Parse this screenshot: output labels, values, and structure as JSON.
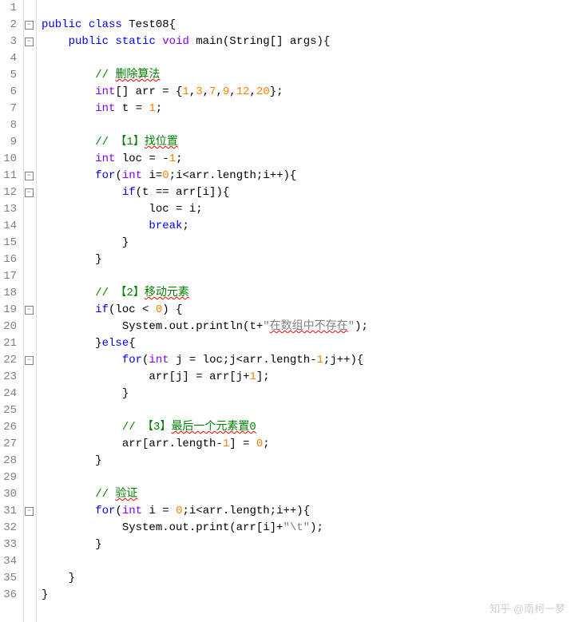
{
  "lines": [
    {
      "n": 1,
      "fold": "",
      "indent": "",
      "tokens": []
    },
    {
      "n": 2,
      "fold": "open",
      "indent": "",
      "tokens": [
        [
          "kw",
          "public"
        ],
        [
          "",
          " "
        ],
        [
          "kw",
          "class"
        ],
        [
          "",
          " Test08{"
        ]
      ]
    },
    {
      "n": 3,
      "fold": "open",
      "indent": "    ",
      "tokens": [
        [
          "kw",
          "public"
        ],
        [
          "",
          " "
        ],
        [
          "kw",
          "static"
        ],
        [
          "",
          " "
        ],
        [
          "ty",
          "void"
        ],
        [
          "",
          " main(String[] args){"
        ]
      ]
    },
    {
      "n": 4,
      "fold": "",
      "indent": "",
      "tokens": []
    },
    {
      "n": 5,
      "fold": "",
      "indent": "        ",
      "tokens": [
        [
          "com",
          "// "
        ],
        [
          "com wavy",
          "删除算法"
        ]
      ]
    },
    {
      "n": 6,
      "fold": "",
      "indent": "        ",
      "tokens": [
        [
          "ty",
          "int"
        ],
        [
          "",
          "[] arr = {"
        ],
        [
          "num",
          "1"
        ],
        [
          "",
          ","
        ],
        [
          "num",
          "3"
        ],
        [
          "",
          ","
        ],
        [
          "num",
          "7"
        ],
        [
          "",
          ","
        ],
        [
          "num",
          "9"
        ],
        [
          "",
          ","
        ],
        [
          "num",
          "12"
        ],
        [
          "",
          ","
        ],
        [
          "num",
          "20"
        ],
        [
          "",
          "};"
        ]
      ]
    },
    {
      "n": 7,
      "fold": "",
      "indent": "        ",
      "tokens": [
        [
          "ty",
          "int"
        ],
        [
          "",
          " t = "
        ],
        [
          "num",
          "1"
        ],
        [
          "",
          ";"
        ]
      ]
    },
    {
      "n": 8,
      "fold": "",
      "indent": "",
      "tokens": []
    },
    {
      "n": 9,
      "fold": "",
      "indent": "        ",
      "tokens": [
        [
          "com",
          "// 【1】"
        ],
        [
          "com wavy",
          "找位置"
        ]
      ]
    },
    {
      "n": 10,
      "fold": "",
      "indent": "        ",
      "tokens": [
        [
          "ty",
          "int"
        ],
        [
          "",
          " loc = -"
        ],
        [
          "num",
          "1"
        ],
        [
          "",
          ";"
        ]
      ]
    },
    {
      "n": 11,
      "fold": "open",
      "indent": "        ",
      "tokens": [
        [
          "kw",
          "for"
        ],
        [
          "",
          "("
        ],
        [
          "ty",
          "int"
        ],
        [
          "",
          " i="
        ],
        [
          "num",
          "0"
        ],
        [
          "",
          ";i<arr.length;i++){"
        ]
      ]
    },
    {
      "n": 12,
      "fold": "open",
      "indent": "            ",
      "tokens": [
        [
          "kw",
          "if"
        ],
        [
          "",
          "(t == arr[i]){"
        ]
      ]
    },
    {
      "n": 13,
      "fold": "",
      "indent": "                ",
      "tokens": [
        [
          "",
          "loc = i;"
        ]
      ]
    },
    {
      "n": 14,
      "fold": "",
      "indent": "                ",
      "tokens": [
        [
          "kw",
          "break"
        ],
        [
          "",
          ";"
        ]
      ]
    },
    {
      "n": 15,
      "fold": "",
      "indent": "            ",
      "tokens": [
        [
          "",
          "}"
        ]
      ]
    },
    {
      "n": 16,
      "fold": "",
      "indent": "        ",
      "tokens": [
        [
          "",
          "}"
        ]
      ]
    },
    {
      "n": 17,
      "fold": "",
      "indent": "",
      "tokens": []
    },
    {
      "n": 18,
      "fold": "",
      "indent": "        ",
      "tokens": [
        [
          "com",
          "// 【2】"
        ],
        [
          "com wavy",
          "移动元素"
        ]
      ]
    },
    {
      "n": 19,
      "fold": "open",
      "indent": "        ",
      "tokens": [
        [
          "kw",
          "if"
        ],
        [
          "",
          "(loc < "
        ],
        [
          "num",
          "0"
        ],
        [
          "",
          ") {"
        ]
      ]
    },
    {
      "n": 20,
      "fold": "",
      "indent": "            ",
      "tokens": [
        [
          "",
          "System.out.println(t+"
        ],
        [
          "str",
          "\""
        ],
        [
          "str wavy",
          "在数组中不存在"
        ],
        [
          "str",
          "\""
        ],
        [
          "",
          ");"
        ]
      ]
    },
    {
      "n": 21,
      "fold": "",
      "indent": "        ",
      "tokens": [
        [
          "",
          "}"
        ],
        [
          "kw",
          "else"
        ],
        [
          "",
          "{"
        ]
      ]
    },
    {
      "n": 22,
      "fold": "open",
      "indent": "            ",
      "tokens": [
        [
          "kw",
          "for"
        ],
        [
          "",
          "("
        ],
        [
          "ty",
          "int"
        ],
        [
          "",
          " j = loc;j<arr.length-"
        ],
        [
          "num",
          "1"
        ],
        [
          "",
          ";j++){"
        ]
      ]
    },
    {
      "n": 23,
      "fold": "",
      "indent": "                ",
      "tokens": [
        [
          "",
          "arr[j] = arr[j+"
        ],
        [
          "num",
          "1"
        ],
        [
          "",
          "];"
        ]
      ]
    },
    {
      "n": 24,
      "fold": "",
      "indent": "            ",
      "tokens": [
        [
          "",
          "}"
        ]
      ]
    },
    {
      "n": 25,
      "fold": "",
      "indent": "",
      "tokens": []
    },
    {
      "n": 26,
      "fold": "",
      "indent": "            ",
      "tokens": [
        [
          "com",
          "// 【3】"
        ],
        [
          "com wavy",
          "最后一个元素置0"
        ]
      ]
    },
    {
      "n": 27,
      "fold": "",
      "indent": "            ",
      "tokens": [
        [
          "",
          "arr[arr.length-"
        ],
        [
          "num",
          "1"
        ],
        [
          "",
          "] = "
        ],
        [
          "num",
          "0"
        ],
        [
          "",
          ";"
        ]
      ]
    },
    {
      "n": 28,
      "fold": "",
      "indent": "        ",
      "tokens": [
        [
          "",
          "}"
        ]
      ]
    },
    {
      "n": 29,
      "fold": "",
      "indent": "",
      "tokens": []
    },
    {
      "n": 30,
      "fold": "",
      "indent": "        ",
      "tokens": [
        [
          "com",
          "// "
        ],
        [
          "com wavy",
          "验证"
        ]
      ]
    },
    {
      "n": 31,
      "fold": "open",
      "indent": "        ",
      "tokens": [
        [
          "kw",
          "for"
        ],
        [
          "",
          "("
        ],
        [
          "ty",
          "int"
        ],
        [
          "",
          " i = "
        ],
        [
          "num",
          "0"
        ],
        [
          "",
          ";i<arr.length;i++){"
        ]
      ]
    },
    {
      "n": 32,
      "fold": "",
      "indent": "            ",
      "tokens": [
        [
          "",
          "System.out.print(arr[i]+"
        ],
        [
          "str",
          "\"\\t\""
        ],
        [
          "",
          ");"
        ]
      ]
    },
    {
      "n": 33,
      "fold": "",
      "indent": "        ",
      "tokens": [
        [
          "",
          "}"
        ]
      ]
    },
    {
      "n": 34,
      "fold": "",
      "indent": "",
      "tokens": []
    },
    {
      "n": 35,
      "fold": "",
      "indent": "    ",
      "tokens": [
        [
          "",
          "}"
        ]
      ]
    },
    {
      "n": 36,
      "fold": "",
      "indent": "",
      "tokens": [
        [
          "",
          "}"
        ]
      ]
    }
  ],
  "line_height": 21,
  "watermark": "知乎 @南柯一梦"
}
